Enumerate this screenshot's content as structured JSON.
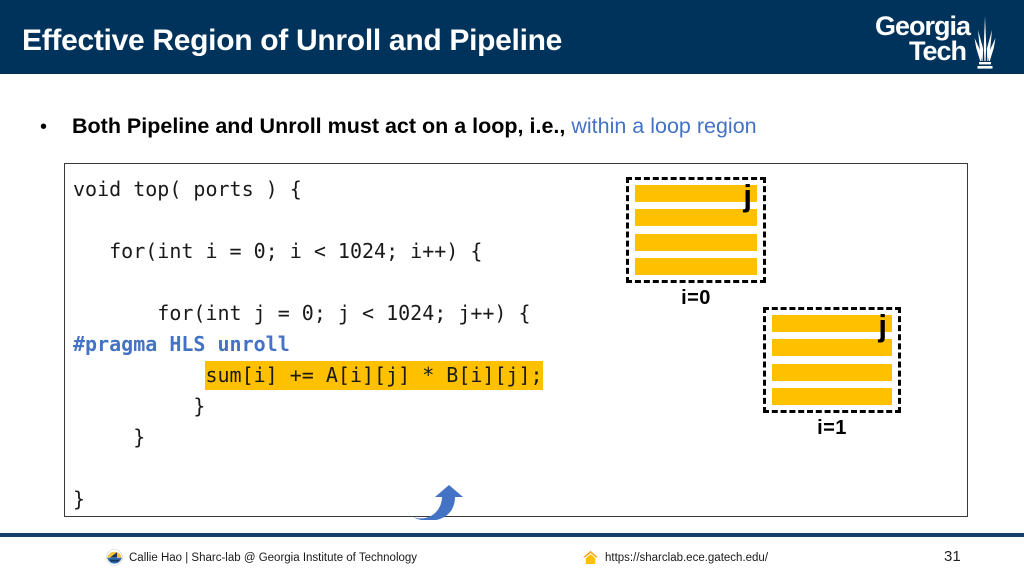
{
  "header": {
    "title": "Effective Region of Unroll and Pipeline",
    "logo": {
      "line1": "Georgia",
      "line2": "Tech",
      "icon": "gt-tower-icon"
    },
    "background_color": "#00335b"
  },
  "bullet": {
    "marker": "•",
    "text_black": "Both Pipeline and Unroll must act on a loop, i.e.,",
    "text_blue": "within a loop region",
    "blue_color": "#4472c4"
  },
  "code": {
    "lines": [
      {
        "text": "void top( ports ) {",
        "style": "plain"
      },
      {
        "text": "",
        "style": "plain"
      },
      {
        "text": "   for(int i = 0; i < 1024; i++) {",
        "style": "plain"
      },
      {
        "text": "",
        "style": "plain"
      },
      {
        "text": "       for(int j = 0; j < 1024; j++) {",
        "style": "plain"
      },
      {
        "text": "#pragma HLS unroll",
        "style": "pragma"
      },
      {
        "text": "           sum[i] += A[i][j] * B[i][j];",
        "style": "highlight",
        "indent": "           ",
        "code": "sum[i] += A[i][j] * B[i][j];"
      },
      {
        "text": "          }",
        "style": "plain"
      },
      {
        "text": "     }",
        "style": "plain"
      },
      {
        "text": "",
        "style": "plain"
      },
      {
        "text": "}",
        "style": "plain"
      }
    ],
    "highlight_color": "#ffc000",
    "pragma_color": "#4472c4",
    "arrow": "curved-up-right-arrow-icon"
  },
  "diagrams": [
    {
      "name": "unroll-iteration-0",
      "axis_label": "j",
      "caption": "i=0",
      "bars": 4,
      "bar_color": "#ffc000"
    },
    {
      "name": "unroll-iteration-1",
      "axis_label": "j",
      "caption": "i=1",
      "bars": 4,
      "bar_color": "#ffc000"
    }
  ],
  "footer": {
    "author": "Callie Hao | Sharc-lab @ Georgia Institute of Technology",
    "url": "https://sharclab.ece.gatech.edu/",
    "page_number": "31",
    "author_icon": "sharc-lab-logo-icon",
    "url_icon": "home-icon",
    "rule_color": "#15406b"
  }
}
